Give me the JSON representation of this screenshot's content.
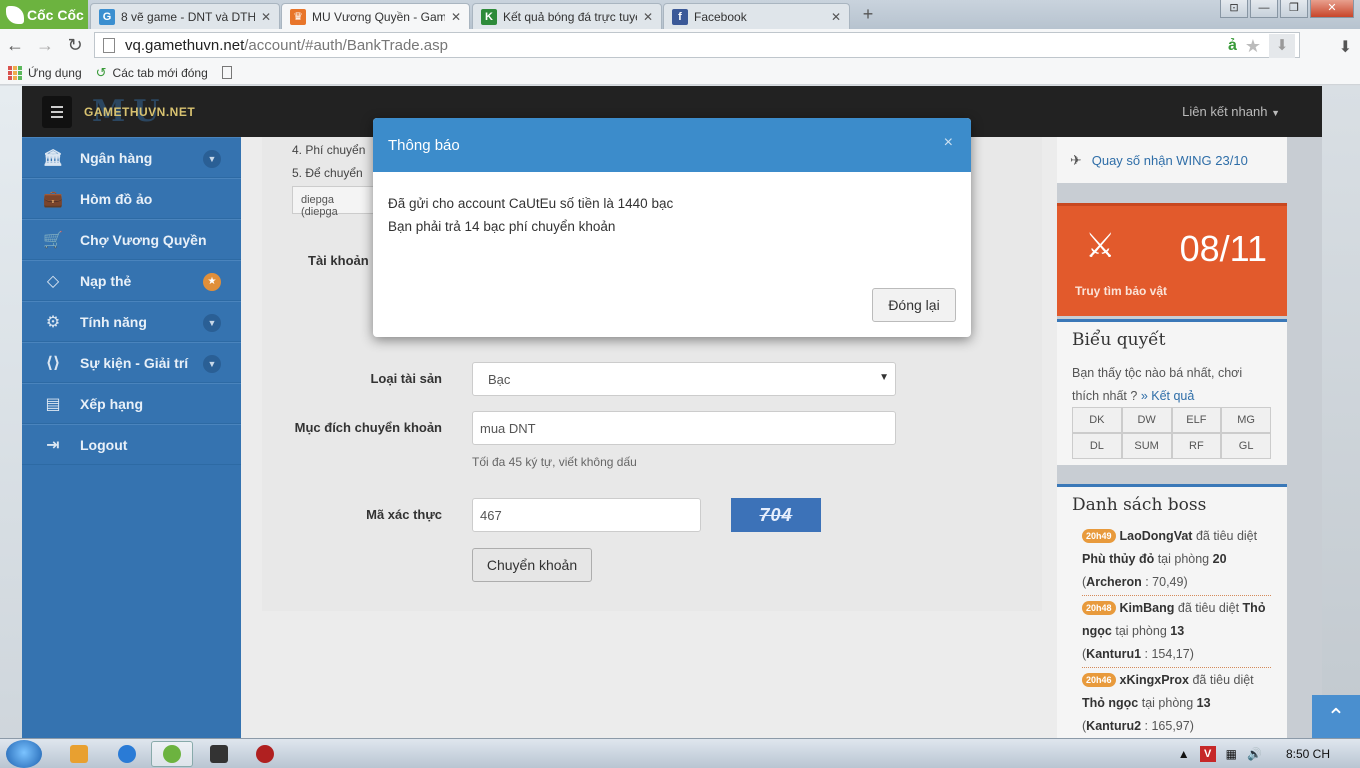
{
  "browser": {
    "brand": "Cốc Cốc",
    "tabs": [
      {
        "title": "8 vẽ game - DNT và DTH |",
        "favicon": "G",
        "color": "#3b8fd0"
      },
      {
        "title": "MU Vương Quyền - Game",
        "favicon": "♛",
        "color": "#e8752a"
      },
      {
        "title": "Kết quả bóng đá trực tuyế",
        "favicon": "K",
        "color": "#2e8b3a"
      },
      {
        "title": "Facebook",
        "favicon": "f",
        "color": "#3b5998"
      }
    ],
    "url_host": "vq.gamethuvn.net",
    "url_path": "/account/#auth/BankTrade.asp",
    "bookmarks": {
      "apps": "Ứng dụng",
      "recent": "Các tab mới đóng"
    }
  },
  "site": {
    "logo_mu": "MU",
    "logo_site": "GAMETHUVN.NET",
    "quicklinks": "Liên kết nhanh",
    "sidebar": [
      {
        "label": "Ngân hàng",
        "icon": "bank-icon",
        "glyph": "🏛",
        "badge": "chevron"
      },
      {
        "label": "Hòm đồ ảo",
        "icon": "briefcase-icon",
        "glyph": "💼",
        "badge": ""
      },
      {
        "label": "Chợ Vương Quyền",
        "icon": "cart-icon",
        "glyph": "🛒",
        "badge": ""
      },
      {
        "label": "Nạp thẻ",
        "icon": "diamond-icon",
        "glyph": "◇",
        "badge": "star"
      },
      {
        "label": "Tính năng",
        "icon": "gears-icon",
        "glyph": "⚙",
        "badge": "chevron"
      },
      {
        "label": "Sự kiện - Giải trí",
        "icon": "code-icon",
        "glyph": "⟨⟩",
        "badge": "chevron"
      },
      {
        "label": "Xếp hạng",
        "icon": "chart-icon",
        "glyph": "▤",
        "badge": ""
      },
      {
        "label": "Logout",
        "icon": "logout-icon",
        "glyph": "⇥",
        "badge": ""
      }
    ],
    "notes": [
      "4. Phí chuyển",
      "5. Để chuyển"
    ],
    "example_input": "diepga (diepga",
    "form": {
      "account_label": "Tài khoản",
      "asset_label": "Loại tài sản",
      "asset_value": "Bạc",
      "purpose_label": "Mục đích chuyển khoản",
      "purpose_value": "mua DNT",
      "purpose_hint": "Tối đa 45 ký tự, viết không dấu",
      "captcha_label": "Mã xác thực",
      "captcha_value": "467",
      "captcha_image_text": "704",
      "submit_label": "Chuyển khoản"
    },
    "right": {
      "wing_link": "Quay số nhận WING 23/10",
      "treasure_date": "08/11",
      "treasure_caption": "Truy tìm bảo vật",
      "poll_title": "Biểu quyết",
      "poll_question": "Bạn thấy tộc nào bá nhất, chơi thích nhất ?",
      "poll_result_link": "» Kết quả",
      "races": [
        "DK",
        "DW",
        "ELF",
        "MG",
        "DL",
        "SUM",
        "RF",
        "GL"
      ],
      "boss_title": "Danh sách boss",
      "boss_killed_text": "đã tiêu diệt",
      "boss_room_text": "tại phòng",
      "bosses": [
        {
          "time": "20h49",
          "player": "LaoDongVat",
          "boss": "Phù thủy đỏ",
          "room": "20",
          "map": "Archeron",
          "coords": "70,49"
        },
        {
          "time": "20h48",
          "player": "KimBang",
          "boss": "Thỏ ngọc",
          "room": "13",
          "map": "Kanturu1",
          "coords": "154,17"
        },
        {
          "time": "20h46",
          "player": "xKingxProx",
          "boss": "Thỏ ngọc",
          "room": "13",
          "map": "Kanturu2",
          "coords": "165,97"
        }
      ]
    }
  },
  "modal": {
    "title": "Thông báo",
    "line1": "Đã gửi cho account CaUtEu số tiền là 1440 bạc",
    "line2": "Bạn phải trả 14 bạc phí chuyển khoản",
    "close_label": "Đóng lại"
  },
  "taskbar": {
    "clock": "8:50 CH"
  }
}
